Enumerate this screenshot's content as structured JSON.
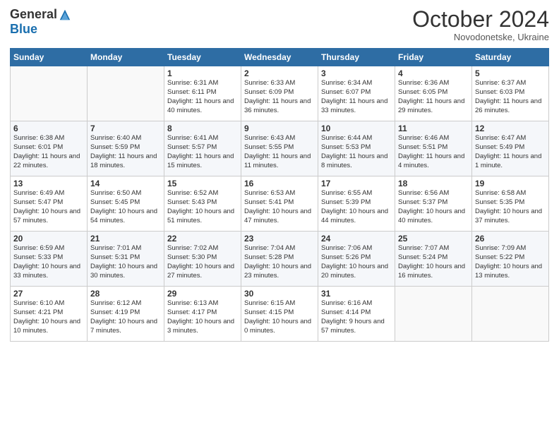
{
  "logo": {
    "general": "General",
    "blue": "Blue"
  },
  "header": {
    "month": "October 2024",
    "location": "Novodonetske, Ukraine"
  },
  "weekdays": [
    "Sunday",
    "Monday",
    "Tuesday",
    "Wednesday",
    "Thursday",
    "Friday",
    "Saturday"
  ],
  "weeks": [
    [
      {
        "day": "",
        "info": ""
      },
      {
        "day": "",
        "info": ""
      },
      {
        "day": "1",
        "info": "Sunrise: 6:31 AM\nSunset: 6:11 PM\nDaylight: 11 hours and 40 minutes."
      },
      {
        "day": "2",
        "info": "Sunrise: 6:33 AM\nSunset: 6:09 PM\nDaylight: 11 hours and 36 minutes."
      },
      {
        "day": "3",
        "info": "Sunrise: 6:34 AM\nSunset: 6:07 PM\nDaylight: 11 hours and 33 minutes."
      },
      {
        "day": "4",
        "info": "Sunrise: 6:36 AM\nSunset: 6:05 PM\nDaylight: 11 hours and 29 minutes."
      },
      {
        "day": "5",
        "info": "Sunrise: 6:37 AM\nSunset: 6:03 PM\nDaylight: 11 hours and 26 minutes."
      }
    ],
    [
      {
        "day": "6",
        "info": "Sunrise: 6:38 AM\nSunset: 6:01 PM\nDaylight: 11 hours and 22 minutes."
      },
      {
        "day": "7",
        "info": "Sunrise: 6:40 AM\nSunset: 5:59 PM\nDaylight: 11 hours and 18 minutes."
      },
      {
        "day": "8",
        "info": "Sunrise: 6:41 AM\nSunset: 5:57 PM\nDaylight: 11 hours and 15 minutes."
      },
      {
        "day": "9",
        "info": "Sunrise: 6:43 AM\nSunset: 5:55 PM\nDaylight: 11 hours and 11 minutes."
      },
      {
        "day": "10",
        "info": "Sunrise: 6:44 AM\nSunset: 5:53 PM\nDaylight: 11 hours and 8 minutes."
      },
      {
        "day": "11",
        "info": "Sunrise: 6:46 AM\nSunset: 5:51 PM\nDaylight: 11 hours and 4 minutes."
      },
      {
        "day": "12",
        "info": "Sunrise: 6:47 AM\nSunset: 5:49 PM\nDaylight: 11 hours and 1 minute."
      }
    ],
    [
      {
        "day": "13",
        "info": "Sunrise: 6:49 AM\nSunset: 5:47 PM\nDaylight: 10 hours and 57 minutes."
      },
      {
        "day": "14",
        "info": "Sunrise: 6:50 AM\nSunset: 5:45 PM\nDaylight: 10 hours and 54 minutes."
      },
      {
        "day": "15",
        "info": "Sunrise: 6:52 AM\nSunset: 5:43 PM\nDaylight: 10 hours and 51 minutes."
      },
      {
        "day": "16",
        "info": "Sunrise: 6:53 AM\nSunset: 5:41 PM\nDaylight: 10 hours and 47 minutes."
      },
      {
        "day": "17",
        "info": "Sunrise: 6:55 AM\nSunset: 5:39 PM\nDaylight: 10 hours and 44 minutes."
      },
      {
        "day": "18",
        "info": "Sunrise: 6:56 AM\nSunset: 5:37 PM\nDaylight: 10 hours and 40 minutes."
      },
      {
        "day": "19",
        "info": "Sunrise: 6:58 AM\nSunset: 5:35 PM\nDaylight: 10 hours and 37 minutes."
      }
    ],
    [
      {
        "day": "20",
        "info": "Sunrise: 6:59 AM\nSunset: 5:33 PM\nDaylight: 10 hours and 33 minutes."
      },
      {
        "day": "21",
        "info": "Sunrise: 7:01 AM\nSunset: 5:31 PM\nDaylight: 10 hours and 30 minutes."
      },
      {
        "day": "22",
        "info": "Sunrise: 7:02 AM\nSunset: 5:30 PM\nDaylight: 10 hours and 27 minutes."
      },
      {
        "day": "23",
        "info": "Sunrise: 7:04 AM\nSunset: 5:28 PM\nDaylight: 10 hours and 23 minutes."
      },
      {
        "day": "24",
        "info": "Sunrise: 7:06 AM\nSunset: 5:26 PM\nDaylight: 10 hours and 20 minutes."
      },
      {
        "day": "25",
        "info": "Sunrise: 7:07 AM\nSunset: 5:24 PM\nDaylight: 10 hours and 16 minutes."
      },
      {
        "day": "26",
        "info": "Sunrise: 7:09 AM\nSunset: 5:22 PM\nDaylight: 10 hours and 13 minutes."
      }
    ],
    [
      {
        "day": "27",
        "info": "Sunrise: 6:10 AM\nSunset: 4:21 PM\nDaylight: 10 hours and 10 minutes."
      },
      {
        "day": "28",
        "info": "Sunrise: 6:12 AM\nSunset: 4:19 PM\nDaylight: 10 hours and 7 minutes."
      },
      {
        "day": "29",
        "info": "Sunrise: 6:13 AM\nSunset: 4:17 PM\nDaylight: 10 hours and 3 minutes."
      },
      {
        "day": "30",
        "info": "Sunrise: 6:15 AM\nSunset: 4:15 PM\nDaylight: 10 hours and 0 minutes."
      },
      {
        "day": "31",
        "info": "Sunrise: 6:16 AM\nSunset: 4:14 PM\nDaylight: 9 hours and 57 minutes."
      },
      {
        "day": "",
        "info": ""
      },
      {
        "day": "",
        "info": ""
      }
    ]
  ]
}
